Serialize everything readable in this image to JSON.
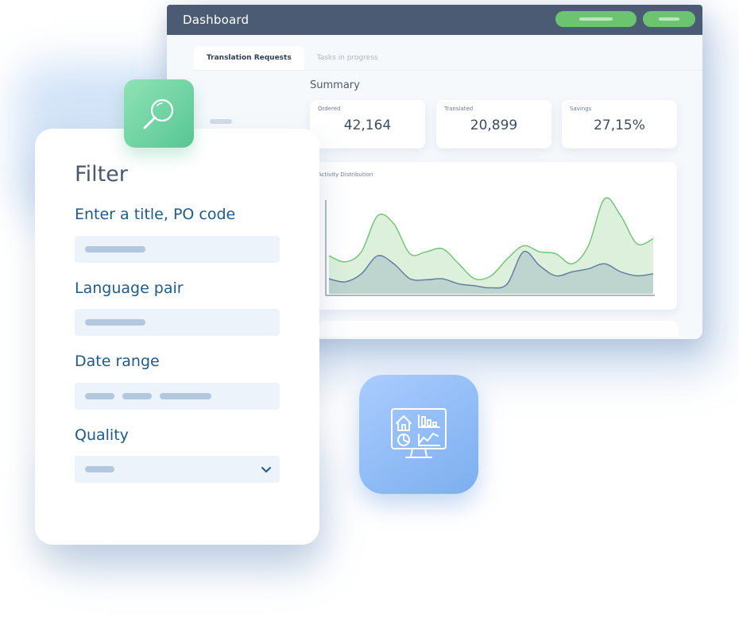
{
  "dashboard": {
    "title": "Dashboard",
    "tabs": [
      {
        "label": "Translation Requests",
        "active": true
      },
      {
        "label": "Tasks in progress",
        "active": false
      }
    ],
    "summary_title": "Summary",
    "stats": [
      {
        "label": "Ordered",
        "value": "42,164"
      },
      {
        "label": "Translated",
        "value": "20,899"
      },
      {
        "label": "Savings",
        "value": "27,15%"
      }
    ],
    "chart_title": "Activity Distribution"
  },
  "filter": {
    "title": "Filter",
    "fields": [
      {
        "label": "Enter a title, PO code"
      },
      {
        "label": "Language pair"
      },
      {
        "label": "Date range"
      },
      {
        "label": "Quality"
      }
    ]
  },
  "icons": {
    "search_tile": "search-icon",
    "monitor_tile": "analytics-monitor-icon"
  },
  "colors": {
    "header": "#4b5b73",
    "accent_green": "#6cc471",
    "filter_label": "#1f5a86",
    "series_green": "#6cc471",
    "series_blue": "#5d7a9c"
  },
  "chart_data": {
    "type": "area",
    "title": "Activity Distribution",
    "xlabel": "",
    "ylabel": "",
    "x": [
      0,
      1,
      2,
      3,
      4,
      5,
      6,
      7,
      8,
      9,
      10,
      11,
      12,
      13,
      14,
      15,
      16,
      17,
      18,
      19,
      20
    ],
    "ylim": [
      0,
      100
    ],
    "grid": false,
    "legend": "none",
    "series": [
      {
        "values": [
          38,
          32,
          42,
          78,
          70,
          40,
          42,
          45,
          30,
          15,
          18,
          35,
          48,
          42,
          40,
          30,
          48,
          95,
          78,
          50,
          55
        ]
      },
      {
        "values": [
          15,
          12,
          20,
          38,
          30,
          15,
          14,
          15,
          10,
          8,
          6,
          10,
          42,
          28,
          18,
          22,
          25,
          30,
          22,
          18,
          20
        ]
      }
    ]
  }
}
